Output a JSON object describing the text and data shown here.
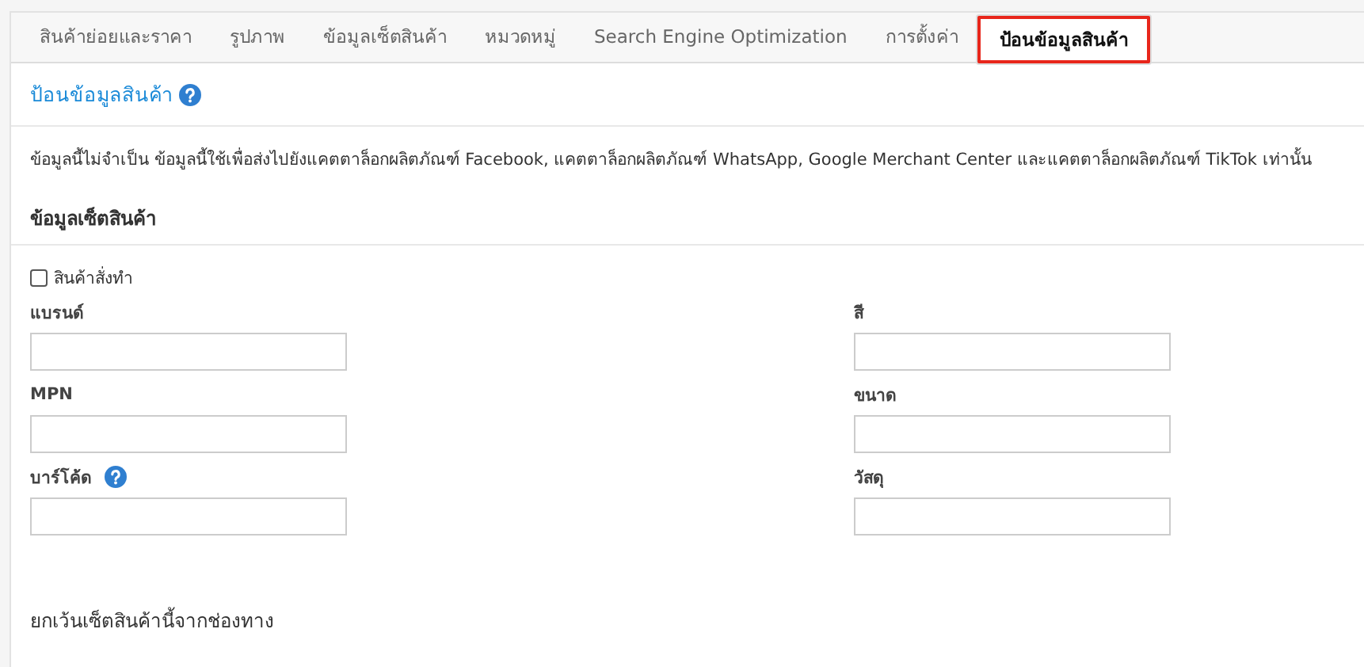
{
  "tabs": [
    {
      "label": "สินค้าย่อยและราคา",
      "selected": false
    },
    {
      "label": "รูปภาพ",
      "selected": false
    },
    {
      "label": "ข้อมูลเซ็ตสินค้า",
      "selected": false
    },
    {
      "label": "หมวดหมู่",
      "selected": false
    },
    {
      "label": "Search Engine Optimization",
      "selected": false
    },
    {
      "label": "การตั้งค่า",
      "selected": false
    },
    {
      "label": "ป้อนข้อมูลสินค้า",
      "selected": true
    }
  ],
  "heading": {
    "title": "ป้อนข้อมูลสินค้า",
    "help": true
  },
  "description": "ข้อมูลนี้ไม่จำเป็น ข้อมูลนี้ใช้เพื่อส่งไปยังแคตตาล็อกผลิตภัณฑ์ Facebook, แคตตาล็อกผลิตภัณฑ์ WhatsApp, Google Merchant Center และแคตตาล็อกผลิตภัณฑ์ TikTok เท่านั้น",
  "section": {
    "title": "ข้อมูลเซ็ตสินค้า",
    "checkbox": {
      "label": "สินค้าสั่งทำ",
      "checked": false
    },
    "fields": [
      {
        "label": "แบรนด์",
        "help": false
      },
      {
        "label": "สี",
        "help": false
      },
      {
        "label": "MPN",
        "help": false
      },
      {
        "label": "ขนาด",
        "help": false
      },
      {
        "label": "บาร์โค้ด",
        "help": true
      },
      {
        "label": "วัสดุ",
        "help": false
      }
    ]
  },
  "footer_heading": "ยกเว้นเซ็ตสินค้านี้จากช่องทาง"
}
